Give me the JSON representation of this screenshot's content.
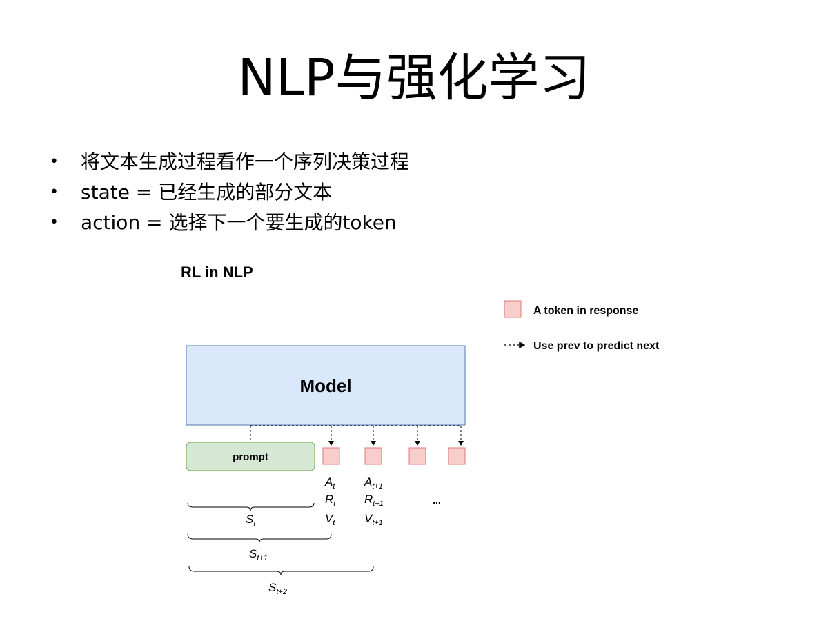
{
  "slide": {
    "title": "NLP与强化学习",
    "bullets": [
      "将文本生成过程看作一个序列决策过程",
      "state = 已经生成的部分文本",
      "action = 选择下一个要生成的token"
    ]
  },
  "diagram": {
    "heading": "RL in NLP",
    "model_label": "Model",
    "prompt_label": "prompt",
    "legend": {
      "token": "A token in response",
      "arrow": "Use prev to predict next"
    },
    "token_labels": [
      {
        "A": "t",
        "R": "t",
        "V": "t"
      },
      {
        "A": "t+1",
        "R": "t+1",
        "V": "t+1"
      }
    ],
    "ellipsis": "...",
    "state_labels": [
      "t",
      "t+1",
      "t+2"
    ],
    "colors": {
      "model_fill": "#dae8fc",
      "model_stroke": "#6c8ebf",
      "prompt_fill": "#d5e8d4",
      "prompt_stroke": "#82b366",
      "token_fill": "#f8cecc",
      "token_stroke": "#b85450"
    }
  }
}
